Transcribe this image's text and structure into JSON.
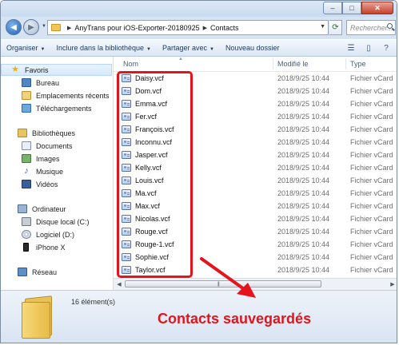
{
  "window": {
    "controls": {
      "minimize": "–",
      "maximize": "□",
      "close": "✕"
    }
  },
  "address": {
    "crumbs": [
      "AnyTrans pour iOS-Exporter-20180925",
      "Contacts"
    ],
    "search_placeholder": "Rechercher..."
  },
  "toolbar": {
    "organize": "Organiser",
    "include_library": "Inclure dans la bibliothèque",
    "share": "Partager avec",
    "new_folder": "Nouveau dossier"
  },
  "sidebar": {
    "favorites": "Favoris",
    "desktop": "Bureau",
    "recent": "Emplacements récents",
    "downloads": "Téléchargements",
    "libraries": "Bibliothèques",
    "documents": "Documents",
    "images": "Images",
    "music": "Musique",
    "videos": "Vidéos",
    "computer": "Ordinateur",
    "local_disk": "Disque local (C:)",
    "software": "Logiciel (D:)",
    "iphone": "iPhone X",
    "network": "Réseau"
  },
  "columns": {
    "name": "Nom",
    "modified": "Modifié le",
    "type": "Type"
  },
  "files": [
    {
      "name": "Daisy.vcf",
      "date": "2018/9/25 10:44",
      "type": "Fichier vCard"
    },
    {
      "name": "Dom.vcf",
      "date": "2018/9/25 10:44",
      "type": "Fichier vCard"
    },
    {
      "name": "Emma.vcf",
      "date": "2018/9/25 10:44",
      "type": "Fichier vCard"
    },
    {
      "name": "Fer.vcf",
      "date": "2018/9/25 10:44",
      "type": "Fichier vCard"
    },
    {
      "name": "François.vcf",
      "date": "2018/9/25 10:44",
      "type": "Fichier vCard"
    },
    {
      "name": "Inconnu.vcf",
      "date": "2018/9/25 10:44",
      "type": "Fichier vCard"
    },
    {
      "name": "Jasper.vcf",
      "date": "2018/9/25 10:44",
      "type": "Fichier vCard"
    },
    {
      "name": "Kelly.vcf",
      "date": "2018/9/25 10:44",
      "type": "Fichier vCard"
    },
    {
      "name": "Louis.vcf",
      "date": "2018/9/25 10:44",
      "type": "Fichier vCard"
    },
    {
      "name": "Ma.vcf",
      "date": "2018/9/25 10:44",
      "type": "Fichier vCard"
    },
    {
      "name": "Max.vcf",
      "date": "2018/9/25 10:44",
      "type": "Fichier vCard"
    },
    {
      "name": "Nicolas.vcf",
      "date": "2018/9/25 10:44",
      "type": "Fichier vCard"
    },
    {
      "name": "Rouge.vcf",
      "date": "2018/9/25 10:44",
      "type": "Fichier vCard"
    },
    {
      "name": "Rouge-1.vcf",
      "date": "2018/9/25 10:44",
      "type": "Fichier vCard"
    },
    {
      "name": "Sophie.vcf",
      "date": "2018/9/25 10:44",
      "type": "Fichier vCard"
    },
    {
      "name": "Taylor.vcf",
      "date": "2018/9/25 10:44",
      "type": "Fichier vCard"
    }
  ],
  "status": {
    "count": "16 élément(s)"
  },
  "callout": {
    "text": "Contacts sauvegardés",
    "color": "#e4131c"
  }
}
